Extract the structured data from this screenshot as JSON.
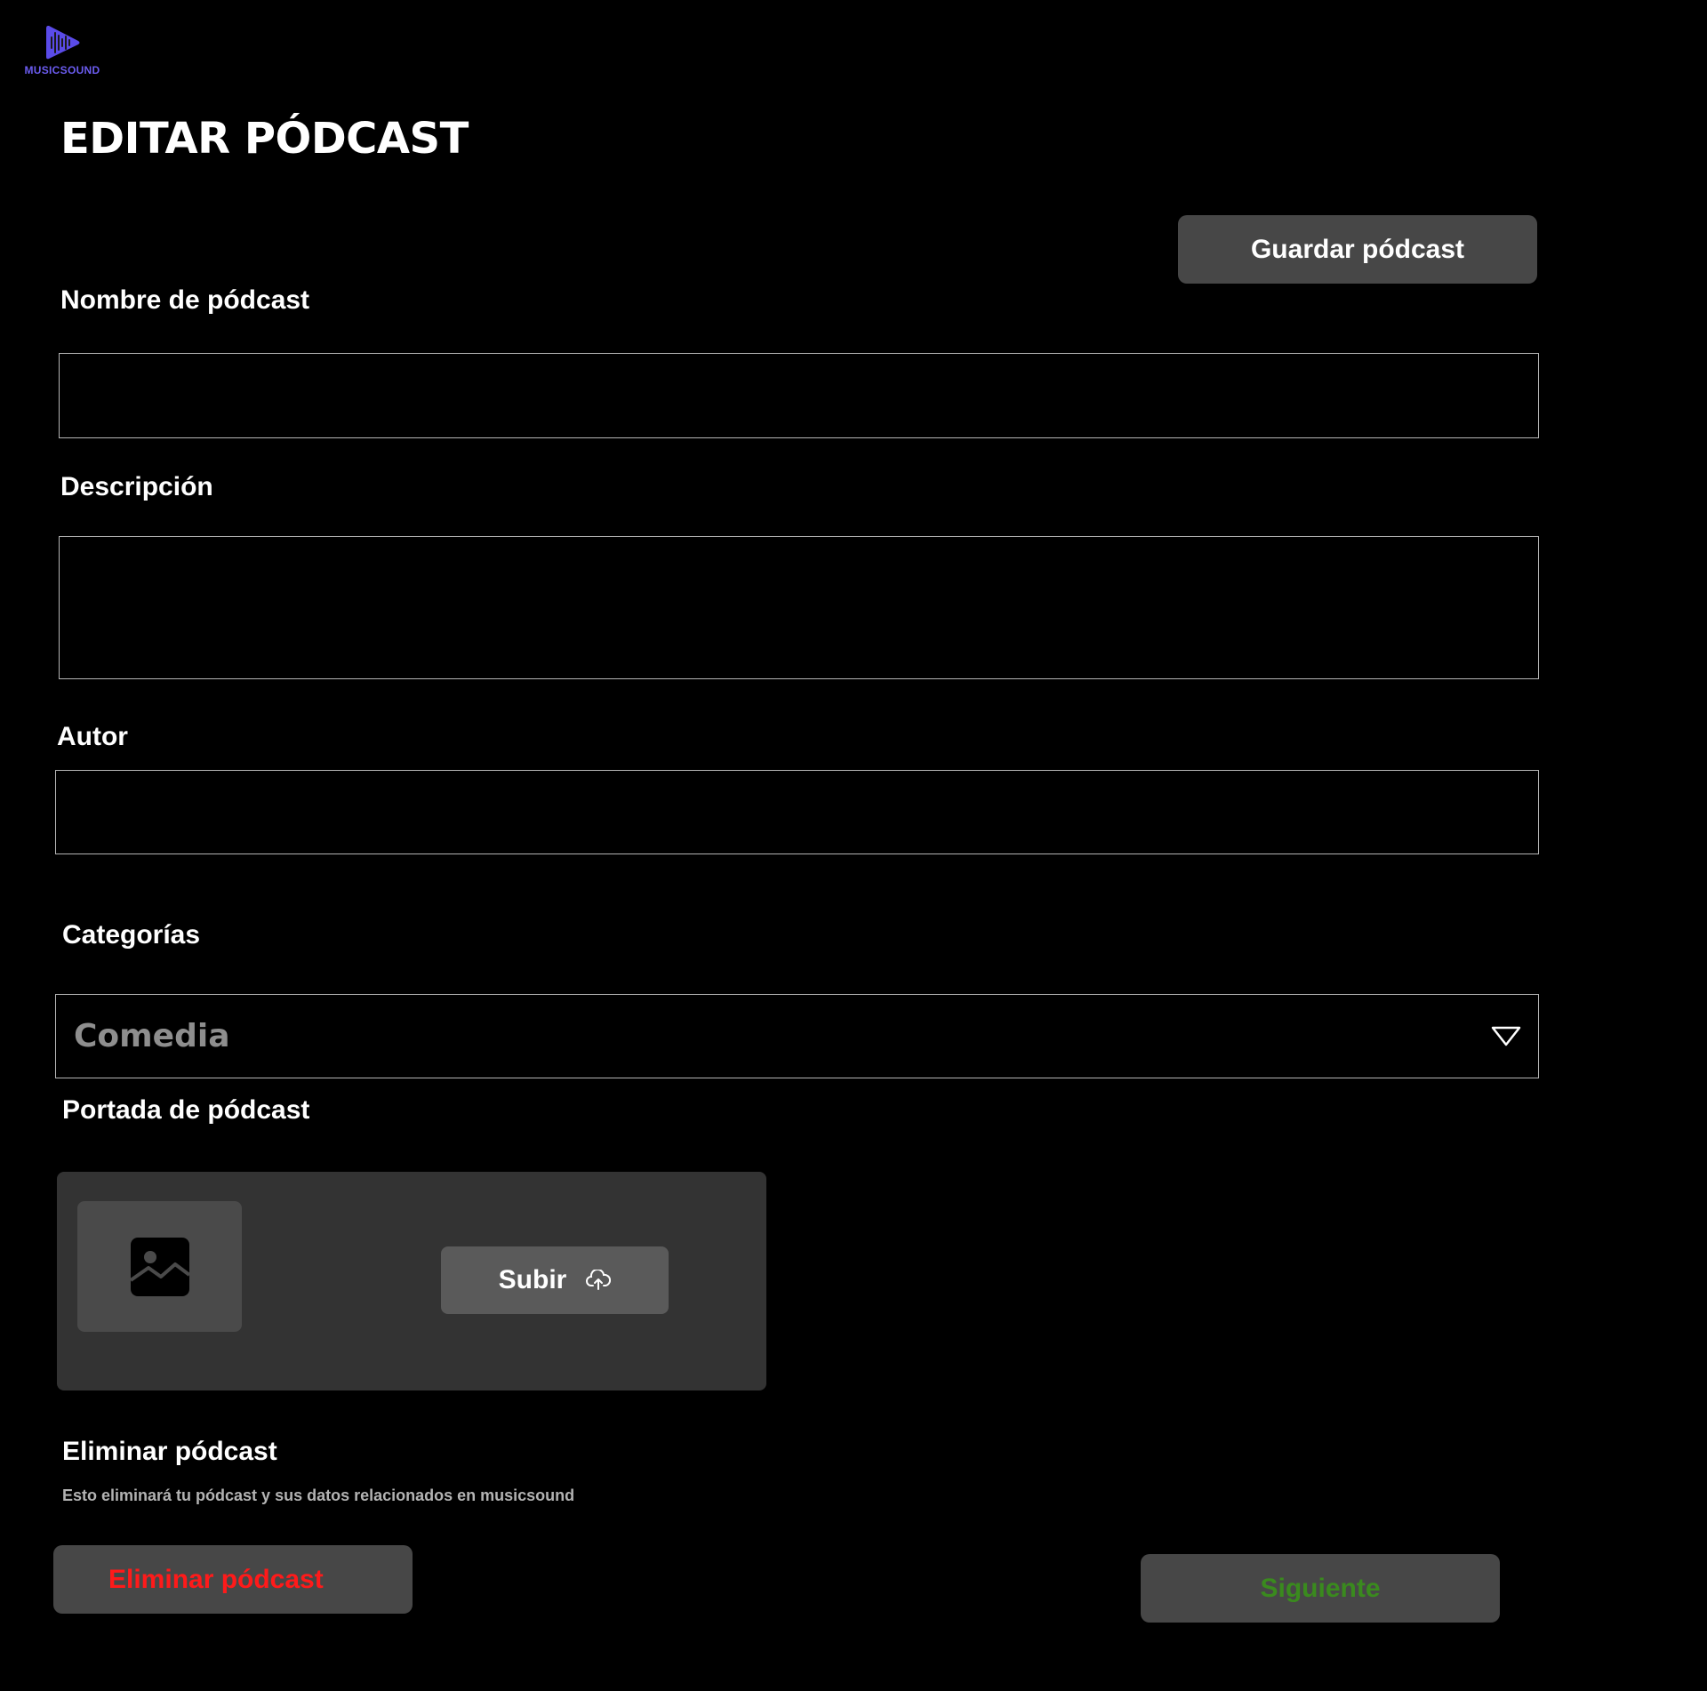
{
  "brand": {
    "name": "MUSICSOUND",
    "color": "#6b5cf0",
    "icon": "play-waveform-icon"
  },
  "page": {
    "title": "EDITAR PÓDCAST"
  },
  "toolbar": {
    "save_label": "Guardar  pódcast"
  },
  "form": {
    "name": {
      "label": "Nombre de pódcast",
      "value": ""
    },
    "description": {
      "label": "Descripción",
      "value": ""
    },
    "author": {
      "label": "Autor",
      "value": ""
    },
    "categories": {
      "label": "Categorías",
      "selected": "Comedia",
      "icon": "triangle-down-icon"
    },
    "cover": {
      "label": "Portada de pódcast",
      "upload_label": "Subir",
      "placeholder_icon": "image-icon",
      "upload_icon": "cloud-upload-icon"
    }
  },
  "danger": {
    "heading": "Eliminar pódcast",
    "note": "Esto eliminará tu pódcast y sus datos relacionados en musicsound",
    "delete_label": "Eliminar pódcast",
    "delete_color": "#ff1a1a"
  },
  "footer": {
    "next_label": "Siguiente",
    "next_color": "#3a8a1e"
  }
}
